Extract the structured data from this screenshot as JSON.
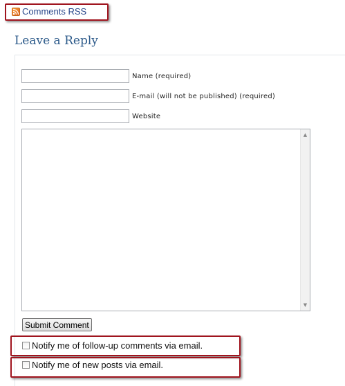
{
  "rss": {
    "label": "Comments RSS",
    "icon": "rss-feed-icon"
  },
  "reply": {
    "title": "Leave a Reply"
  },
  "form": {
    "name_label": "Name (required)",
    "name_value": "",
    "email_label": "E-mail (will not be published) (required)",
    "email_value": "",
    "website_label": "Website",
    "website_value": "",
    "comment_value": "",
    "submit_label": "Submit Comment"
  },
  "notify": {
    "followup_label": "Notify me of follow-up comments via email.",
    "followup_checked": false,
    "newposts_label": "Notify me of new posts via email.",
    "newposts_checked": false
  },
  "colors": {
    "highlight_border": "#a0141e",
    "title": "#2c5a8a",
    "link": "#26468a"
  }
}
